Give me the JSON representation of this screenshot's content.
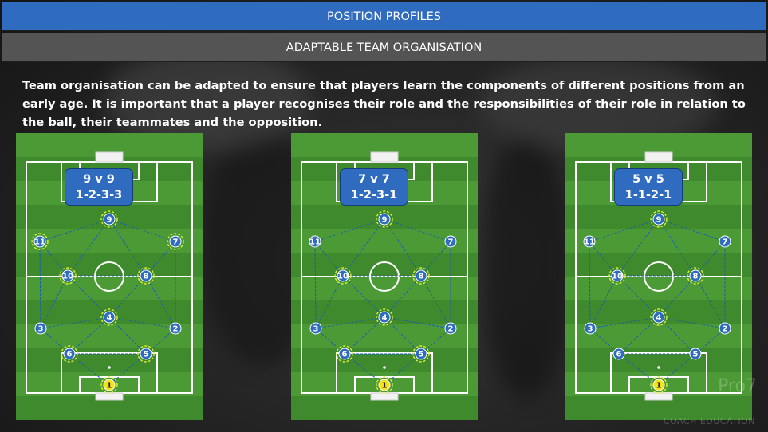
{
  "header": {
    "title": "POSITION PROFILES",
    "subtitle": "ADAPTABLE TEAM ORGANISATION"
  },
  "intro_text": "Team organisation can be adapted to ensure that players learn the components of different positions from an early age. It is important that a player recognises their role and the responsibilities of their role in relation to the ball, their teammates and the opposition.",
  "pitches": [
    {
      "format": "9 v 9",
      "formation": "1-2-3-3"
    },
    {
      "format": "7 v 7",
      "formation": "1-2-3-1"
    },
    {
      "format": "5 v 5",
      "formation": "1-1-2-1"
    }
  ],
  "brand": {
    "name": "Pro7",
    "tagline": "COACH EDUCATION"
  },
  "colors": {
    "header_blue": "#2f6bbf",
    "subheader_grey": "#545454",
    "pitch_green_light": "#4c9a36",
    "pitch_green_dark": "#3f8a2c",
    "player_blue": "#2f6bbf",
    "goalkeeper_yellow": "#f3e21c",
    "highlight_ring": "#d9ef34",
    "link_line": "#1a5fb0"
  }
}
